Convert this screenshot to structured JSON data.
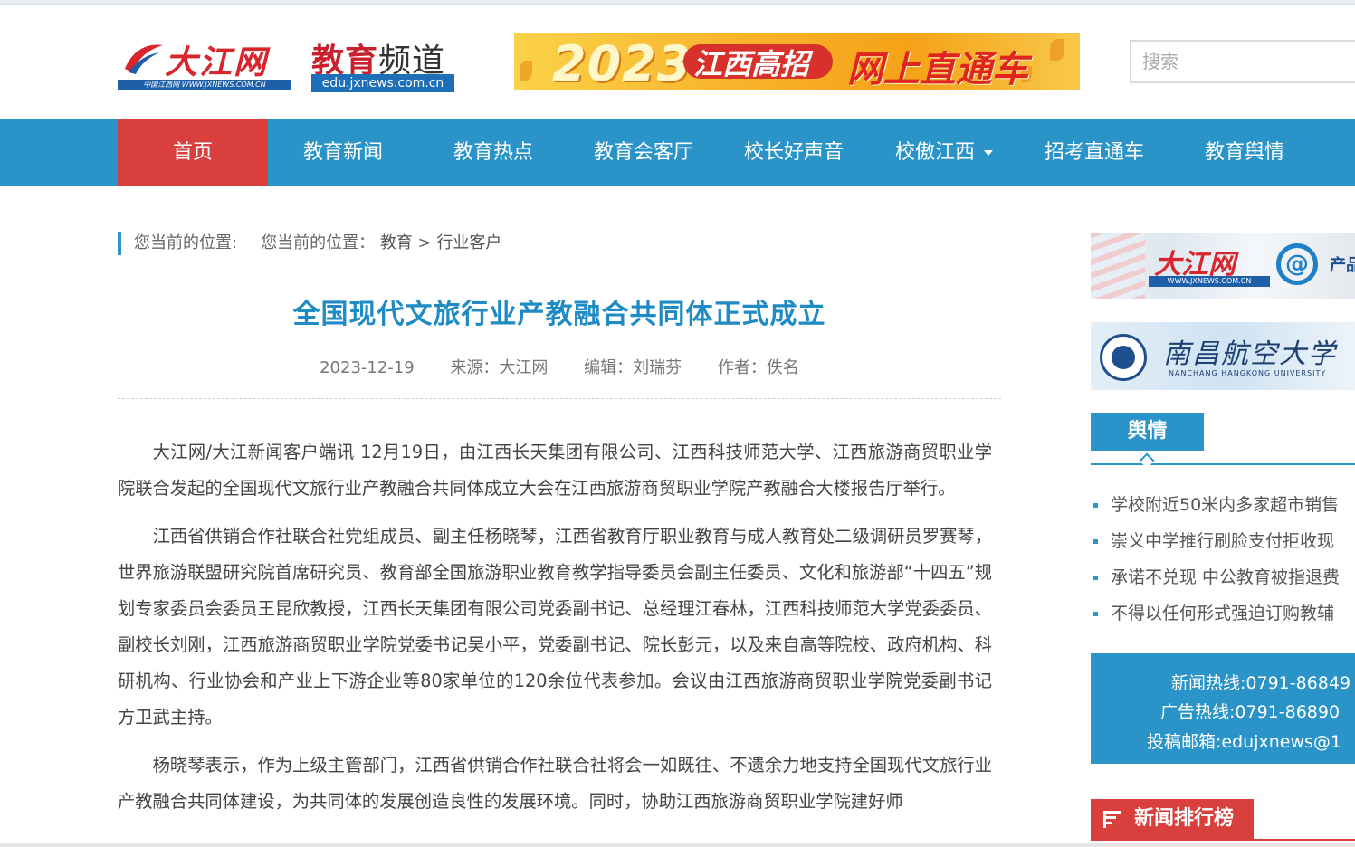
{
  "header": {
    "logo_djw_name": "大江网",
    "logo_djw_url": "中国江西网 WWW.JXNEWS.COM.CN",
    "logo_edu_title_a": "教育",
    "logo_edu_title_b": "频道",
    "logo_edu_url": "edu.jxnews.com.cn",
    "banner_year": "2023",
    "banner_text1": "江西高招",
    "banner_text2": "网上直通车",
    "search_placeholder": "搜索"
  },
  "nav": {
    "items": [
      {
        "label": "首页",
        "active": true
      },
      {
        "label": "教育新闻"
      },
      {
        "label": "教育热点"
      },
      {
        "label": "教育会客厅"
      },
      {
        "label": "校长好声音"
      },
      {
        "label": "校傲江西",
        "dropdown": true
      },
      {
        "label": "招考直通车"
      },
      {
        "label": "教育舆情"
      }
    ]
  },
  "breadcrumb": {
    "prefix": "您当前的位置:",
    "prefix2": "您当前的位置：",
    "level1": "教育",
    "sep": ">",
    "level2": "行业客户"
  },
  "article": {
    "title": "全国现代文旅行业产教融合共同体正式成立",
    "date": "2023-12-19",
    "source": "来源：大江网",
    "editor": "编辑：刘瑞芬",
    "author": "作者：佚名",
    "paragraphs": [
      "大江网/大江新闻客户端讯 12月19日，由江西长天集团有限公司、江西科技师范大学、江西旅游商贸职业学院联合发起的全国现代文旅行业产教融合共同体成立大会在江西旅游商贸职业学院产教融合大楼报告厅举行。",
      "江西省供销合作社联合社党组成员、副主任杨晓琴，江西省教育厅职业教育与成人教育处二级调研员罗赛琴，世界旅游联盟研究院首席研究员、教育部全国旅游职业教育教学指导委员会副主任委员、文化和旅游部“十四五”规划专家委员会委员王昆欣教授，江西长天集团有限公司党委副书记、总经理江春林，江西科技师范大学党委委员、副校长刘刚，江西旅游商贸职业学院党委书记吴小平，党委副书记、院长彭元，以及来自高等院校、政府机构、科研机构、行业协会和产业上下游企业等80家单位的120余位代表参加。会议由江西旅游商贸职业学院党委副书记方卫武主持。",
      "杨晓琴表示，作为上级主管部门，江西省供销合作社联合社将会一如既往、不遗余力地支持全国现代文旅行业产教融合共同体建设，为共同体的发展创造良性的发展环境。同时，协助江西旅游商贸职业学院建好师"
    ]
  },
  "sidebar": {
    "ad1_name": "大江网",
    "ad1_url": "WWW.JXNEWS.COM.CN",
    "ad1_at": "@",
    "ad1_product": "产品",
    "ad2_name": "南昌航空大学",
    "ad2_en": "NANCHANG HANGKONG UNIVERSITY",
    "tab_label": "舆情",
    "news": [
      "学校附近50米内多家超市销售",
      "崇义中学推行刷脸支付拒收现",
      "承诺不兑现 中公教育被指退费",
      "不得以任何形式强迫订购教辅"
    ],
    "hotline_news": "新闻热线:0791-86849",
    "hotline_ad": "广告热线:0791-86890",
    "hotline_mail": "投稿邮箱:edujxnews@1",
    "rank_label": "新闻排行榜"
  },
  "colors": {
    "nav_bg": "#2a94c9",
    "nav_active": "#d9403d",
    "title": "#1f8bc4",
    "accent_red": "#d9403d"
  }
}
